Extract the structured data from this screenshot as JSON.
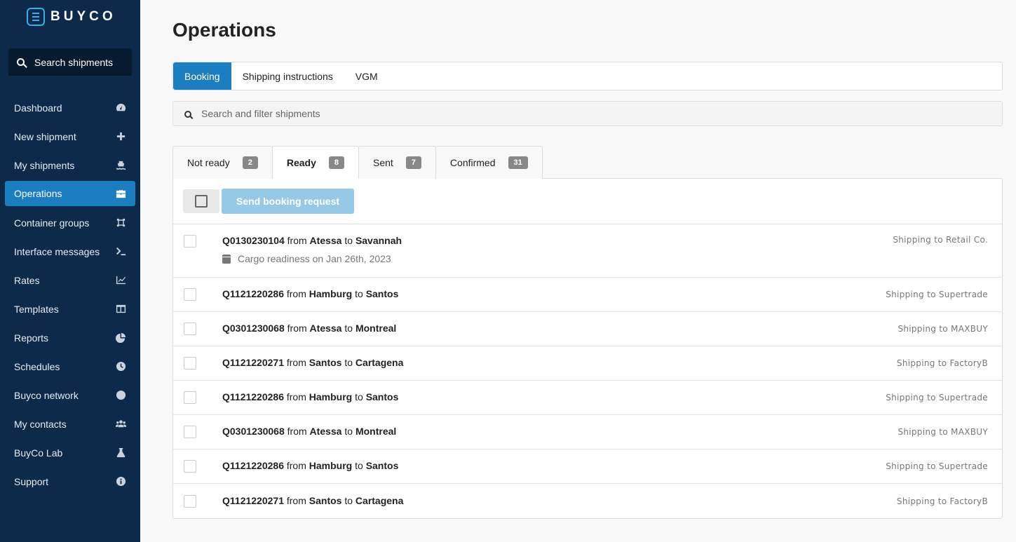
{
  "brand": {
    "name": "BUYCO"
  },
  "sidebar": {
    "search_placeholder": "Search shipments",
    "items": [
      {
        "label": "Dashboard",
        "icon": "dashboard-icon"
      },
      {
        "label": "New shipment",
        "icon": "plus-icon"
      },
      {
        "label": "My shipments",
        "icon": "ship-icon"
      },
      {
        "label": "Operations",
        "icon": "briefcase-icon",
        "active": true
      },
      {
        "label": "Container groups",
        "icon": "container-icon"
      },
      {
        "label": "Interface messages",
        "icon": "terminal-icon"
      },
      {
        "label": "Rates",
        "icon": "chart-line-icon"
      },
      {
        "label": "Templates",
        "icon": "columns-icon"
      },
      {
        "label": "Reports",
        "icon": "pie-chart-icon"
      },
      {
        "label": "Schedules",
        "icon": "clock-icon"
      },
      {
        "label": "Buyco network",
        "icon": "globe-icon"
      },
      {
        "label": "My contacts",
        "icon": "users-icon"
      },
      {
        "label": "BuyCo Lab",
        "icon": "flask-icon"
      },
      {
        "label": "Support",
        "icon": "info-icon"
      }
    ]
  },
  "main": {
    "title": "Operations",
    "tabs": [
      {
        "label": "Booking",
        "active": true
      },
      {
        "label": "Shipping instructions"
      },
      {
        "label": "VGM"
      }
    ],
    "filter_placeholder": "Search and filter shipments",
    "status_tabs": [
      {
        "label": "Not ready",
        "count": "2"
      },
      {
        "label": "Ready",
        "count": "8",
        "active": true
      },
      {
        "label": "Sent",
        "count": "7"
      },
      {
        "label": "Confirmed",
        "count": "31"
      }
    ],
    "send_button": "Send booking request",
    "shipments": [
      {
        "id": "Q0130230104",
        "from_word": "from",
        "from": "Atessa",
        "to_word": "to",
        "to": "Savannah",
        "readiness": "Cargo readiness on Jan 26th, 2023",
        "shipping_to": "Shipping to Retail Co."
      },
      {
        "id": "Q1121220286",
        "from_word": "from",
        "from": "Hamburg",
        "to_word": "to",
        "to": "Santos",
        "shipping_to": "Shipping to Supertrade"
      },
      {
        "id": "Q0301230068",
        "from_word": "from",
        "from": "Atessa",
        "to_word": "to",
        "to": "Montreal",
        "shipping_to": "Shipping to MAXBUY"
      },
      {
        "id": "Q1121220271",
        "from_word": "from",
        "from": "Santos",
        "to_word": "to",
        "to": "Cartagena",
        "shipping_to": "Shipping to FactoryB"
      },
      {
        "id": "Q1121220286",
        "from_word": "from",
        "from": "Hamburg",
        "to_word": "to",
        "to": "Santos",
        "shipping_to": "Shipping to Supertrade"
      },
      {
        "id": "Q0301230068",
        "from_word": "from",
        "from": "Atessa",
        "to_word": "to",
        "to": "Montreal",
        "shipping_to": "Shipping to MAXBUY"
      },
      {
        "id": "Q1121220286",
        "from_word": "from",
        "from": "Hamburg",
        "to_word": "to",
        "to": "Santos",
        "shipping_to": "Shipping to Supertrade"
      },
      {
        "id": "Q1121220271",
        "from_word": "from",
        "from": "Santos",
        "to_word": "to",
        "to": "Cartagena",
        "shipping_to": "Shipping to FactoryB"
      }
    ]
  },
  "colors": {
    "sidebar_bg": "#0d2a4a",
    "accent": "#1a7ec0",
    "send_button_disabled": "#95c9e6"
  }
}
